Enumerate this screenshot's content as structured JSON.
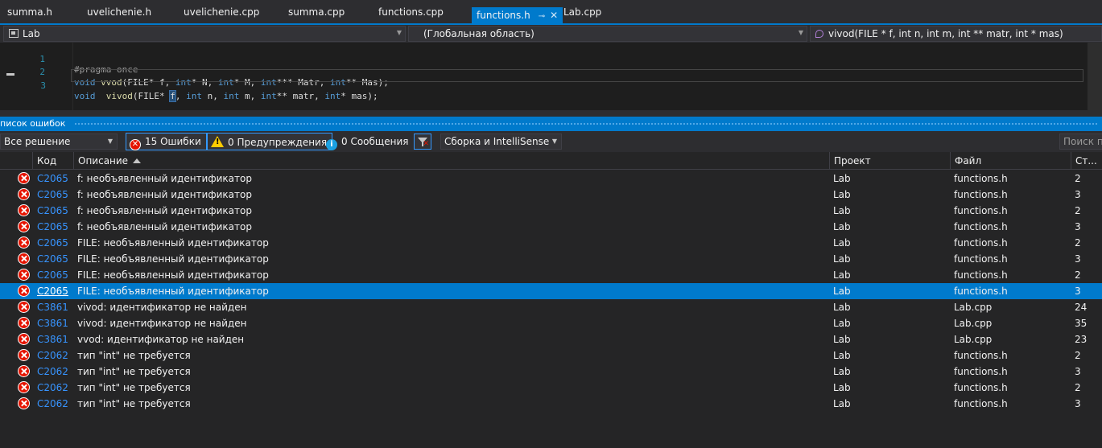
{
  "tabs": [
    {
      "label": "summa.h",
      "active": false
    },
    {
      "label": "uvelichenie.h",
      "active": false
    },
    {
      "label": "uvelichenie.cpp",
      "active": false
    },
    {
      "label": "summa.cpp",
      "active": false
    },
    {
      "label": "functions.cpp",
      "active": false
    },
    {
      "label": "functions.h",
      "active": true
    },
    {
      "label": "Lab.cpp",
      "active": false
    }
  ],
  "navbar": {
    "project": "Lab",
    "scope": "(Глобальная область)",
    "member": "vivod(FILE * f, int n, int m, int ** matr, int * mas)"
  },
  "editor": {
    "lines": [
      {
        "number": "1",
        "text": "#pragma once"
      },
      {
        "number": "2",
        "text": "void vvod(FILE* f, int* N, int* M, int*** Matr, int** Mas);"
      },
      {
        "number": "3",
        "text": "void  vivod(FILE* f, int n, int m, int** matr, int* mas);"
      }
    ]
  },
  "error_list": {
    "title": "писок ошибок",
    "scope_filter": "Все решение",
    "errors_button": "15 Ошибки",
    "warnings_button": "0 Предупреждения",
    "messages_button": "0 Сообщения",
    "build_filter": "Сборка и IntelliSense",
    "search_placeholder": "Поиск по",
    "columns": {
      "code": "Код",
      "description": "Описание",
      "project": "Проект",
      "file": "Файл",
      "line": "Ст..."
    },
    "rows": [
      {
        "code": "C2065",
        "description": "f: необъявленный идентификатор",
        "project": "Lab",
        "file": "functions.h",
        "line": "2",
        "selected": false
      },
      {
        "code": "C2065",
        "description": "f: необъявленный идентификатор",
        "project": "Lab",
        "file": "functions.h",
        "line": "3",
        "selected": false
      },
      {
        "code": "C2065",
        "description": "f: необъявленный идентификатор",
        "project": "Lab",
        "file": "functions.h",
        "line": "2",
        "selected": false
      },
      {
        "code": "C2065",
        "description": "f: необъявленный идентификатор",
        "project": "Lab",
        "file": "functions.h",
        "line": "3",
        "selected": false
      },
      {
        "code": "C2065",
        "description": "FILE: необъявленный идентификатор",
        "project": "Lab",
        "file": "functions.h",
        "line": "2",
        "selected": false
      },
      {
        "code": "C2065",
        "description": "FILE: необъявленный идентификатор",
        "project": "Lab",
        "file": "functions.h",
        "line": "3",
        "selected": false
      },
      {
        "code": "C2065",
        "description": "FILE: необъявленный идентификатор",
        "project": "Lab",
        "file": "functions.h",
        "line": "2",
        "selected": false
      },
      {
        "code": "C2065",
        "description": "FILE: необъявленный идентификатор",
        "project": "Lab",
        "file": "functions.h",
        "line": "3",
        "selected": true
      },
      {
        "code": "C3861",
        "description": "vivod: идентификатор не найден",
        "project": "Lab",
        "file": "Lab.cpp",
        "line": "24",
        "selected": false
      },
      {
        "code": "C3861",
        "description": "vivod: идентификатор не найден",
        "project": "Lab",
        "file": "Lab.cpp",
        "line": "35",
        "selected": false
      },
      {
        "code": "C3861",
        "description": "vvod: идентификатор не найден",
        "project": "Lab",
        "file": "Lab.cpp",
        "line": "23",
        "selected": false
      },
      {
        "code": "C2062",
        "description": "тип \"int\" не требуется",
        "project": "Lab",
        "file": "functions.h",
        "line": "2",
        "selected": false
      },
      {
        "code": "C2062",
        "description": "тип \"int\" не требуется",
        "project": "Lab",
        "file": "functions.h",
        "line": "3",
        "selected": false
      },
      {
        "code": "C2062",
        "description": "тип \"int\" не требуется",
        "project": "Lab",
        "file": "functions.h",
        "line": "2",
        "selected": false
      },
      {
        "code": "C2062",
        "description": "тип \"int\" не требуется",
        "project": "Lab",
        "file": "functions.h",
        "line": "3",
        "selected": false
      }
    ]
  }
}
